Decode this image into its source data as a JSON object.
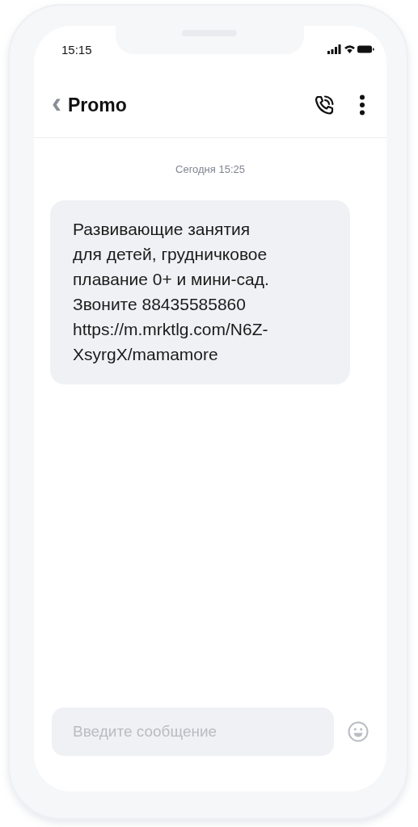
{
  "status_bar": {
    "time": "15:15"
  },
  "header": {
    "back": "‹",
    "title": "Promo"
  },
  "date_label": "Сегодня 15:25",
  "messages": [
    {
      "text": "Развивающие занятия\nдля детей, грудничковое\nплавание 0+ и мини-сад.\nЗвоните 88435585860\nhttps://m.mrktlg.com/N6Z-\nXsyrgX/mamamore"
    }
  ],
  "composer": {
    "placeholder": "Введите сообщение"
  }
}
